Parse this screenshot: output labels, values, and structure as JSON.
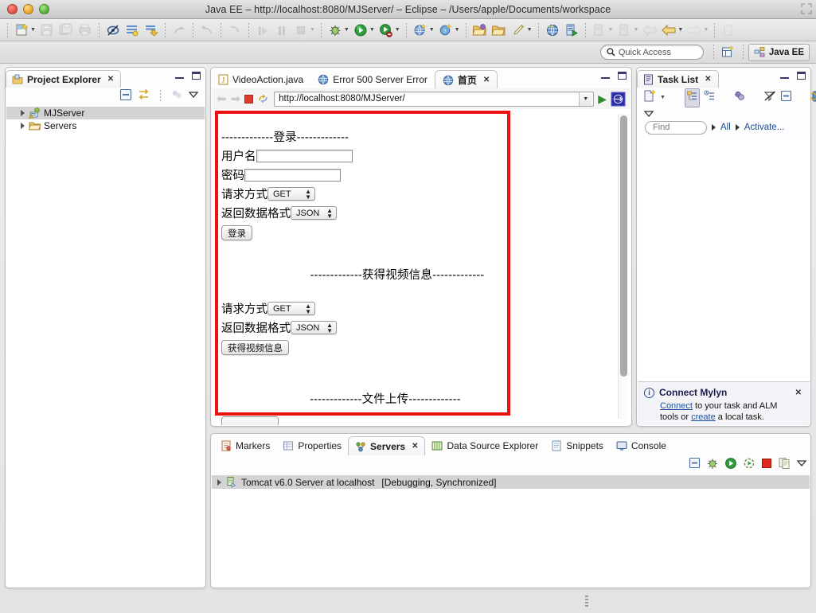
{
  "window": {
    "title": "Java EE – http://localhost:8080/MJServer/ – Eclipse – /Users/apple/Documents/workspace",
    "traffic": {
      "close": "close-button",
      "minimize": "minimize-button",
      "zoom": "zoom-button"
    }
  },
  "quick_access": {
    "placeholder": "Quick Access",
    "perspective_label": "Java EE"
  },
  "project_explorer": {
    "tab_label": "Project Explorer",
    "items": [
      {
        "label": "MJServer",
        "selected": true
      },
      {
        "label": "Servers",
        "selected": false
      }
    ]
  },
  "editor": {
    "tabs": [
      {
        "label": "VideoAction.java",
        "icon": "java-file-icon",
        "active": false
      },
      {
        "label": "Error 500 Server Error",
        "icon": "globe-icon",
        "active": false
      },
      {
        "label": "首页",
        "icon": "globe-icon",
        "active": true
      }
    ],
    "browser": {
      "url": "http://localhost:8080/MJServer/",
      "back": "back-arrow-icon",
      "forward": "forward-arrow-icon",
      "stop": "stop-icon",
      "refresh": "refresh-icon",
      "go": "go-icon",
      "external": "open-external-browser-icon"
    },
    "page": {
      "section_login": "-------------登录-------------",
      "label_username": "用户名",
      "label_password": "密码",
      "label_method": "请求方式",
      "label_format": "返回数据格式",
      "value_username": "",
      "value_password": "",
      "method_value": "GET",
      "format_value": "JSON",
      "button_login": "登录",
      "section_video": "-------------获得视频信息-------------",
      "video_label_method": "请求方式",
      "video_label_format": "返回数据格式",
      "video_method_value": "GET",
      "video_format_value": "JSON",
      "button_video": "获得视频信息",
      "section_upload": "-------------文件上传-------------"
    }
  },
  "task_list": {
    "tab_label": "Task List",
    "find_placeholder": "Find",
    "filter_all": "All",
    "filter_activate": "Activate...",
    "mylyn": {
      "title": "Connect Mylyn",
      "text_1": "Connect",
      "text_2": " to your task and ALM",
      "text_3": "tools or ",
      "text_4": "create",
      "text_5": " a local task."
    }
  },
  "bottom_panel": {
    "tabs": [
      {
        "label": "Markers",
        "icon": "markers-icon",
        "active": false
      },
      {
        "label": "Properties",
        "icon": "properties-icon",
        "active": false
      },
      {
        "label": "Servers",
        "icon": "servers-icon",
        "active": true
      },
      {
        "label": "Data Source Explorer",
        "icon": "datasource-icon",
        "active": false
      },
      {
        "label": "Snippets",
        "icon": "snippets-icon",
        "active": false
      },
      {
        "label": "Console",
        "icon": "console-icon",
        "active": false
      }
    ],
    "server_row": {
      "name": "Tomcat v6.0 Server at localhost",
      "status": "[Debugging, Synchronized]"
    }
  },
  "colors": {
    "accent_red": "#ee1111",
    "link_blue": "#1b4f9c",
    "selection_gray": "#d3d3d3",
    "chrome_gray": "#e3e3e3"
  }
}
